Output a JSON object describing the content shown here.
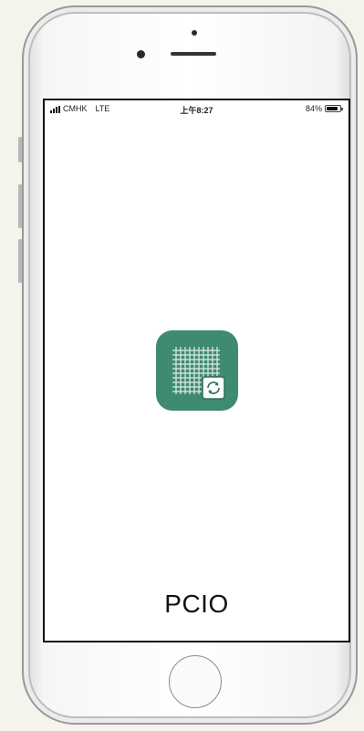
{
  "status_bar": {
    "carrier": "CMHK",
    "network": "LTE",
    "time": "上午8:27",
    "battery_text": "84%",
    "battery_level": 0.84
  },
  "app": {
    "name": "PCIO",
    "icon": "pcio-app-icon",
    "icon_color": "#3f8a72"
  },
  "device": {
    "home_button_icon": "home-button"
  }
}
